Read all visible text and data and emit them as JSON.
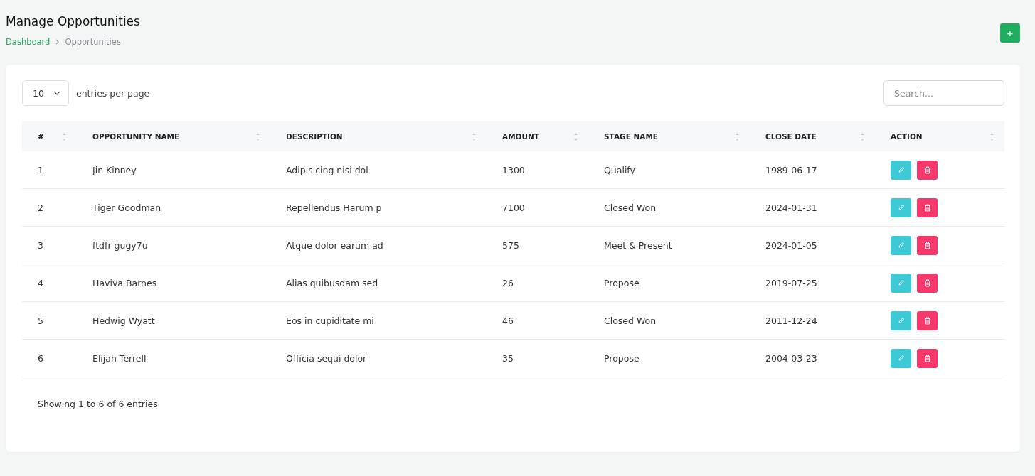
{
  "page": {
    "title": "Manage Opportunities",
    "add_button": "+"
  },
  "breadcrumb": [
    {
      "label": "Dashboard",
      "kind": "link"
    },
    {
      "label": "Opportunities",
      "kind": "current"
    }
  ],
  "page_size": {
    "value": "10",
    "label": "entries per page"
  },
  "search": {
    "placeholder": "Search..."
  },
  "table": {
    "columns": [
      "#",
      "OPPORTUNITY NAME",
      "DESCRIPTION",
      "AMOUNT",
      "STAGE NAME",
      "CLOSE DATE",
      "ACTION"
    ],
    "rows": [
      {
        "cells": [
          "1",
          "Jin Kinney",
          "Adipisicing nisi dol",
          "1300",
          "Qualify",
          "1989-06-17"
        ]
      },
      {
        "cells": [
          "2",
          "Tiger Goodman",
          "Repellendus Harum p",
          "7100",
          "Closed Won",
          "2024-01-31"
        ]
      },
      {
        "cells": [
          "3",
          "ftdfr gugy7u",
          "Atque dolor earum ad",
          "575",
          "Meet & Present",
          "2024-01-05"
        ]
      },
      {
        "cells": [
          "4",
          "Haviva Barnes",
          "Alias quibusdam sed",
          "26",
          "Propose",
          "2019-07-25"
        ]
      },
      {
        "cells": [
          "5",
          "Hedwig Wyatt",
          "Eos in cupiditate mi",
          "46",
          "Closed Won",
          "2011-12-24"
        ]
      },
      {
        "cells": [
          "6",
          "Elijah Terrell",
          "Officia sequi dolor",
          "35",
          "Propose",
          "2004-03-23"
        ]
      }
    ]
  },
  "footer": "Showing 1 to 6 of 6 entries"
}
